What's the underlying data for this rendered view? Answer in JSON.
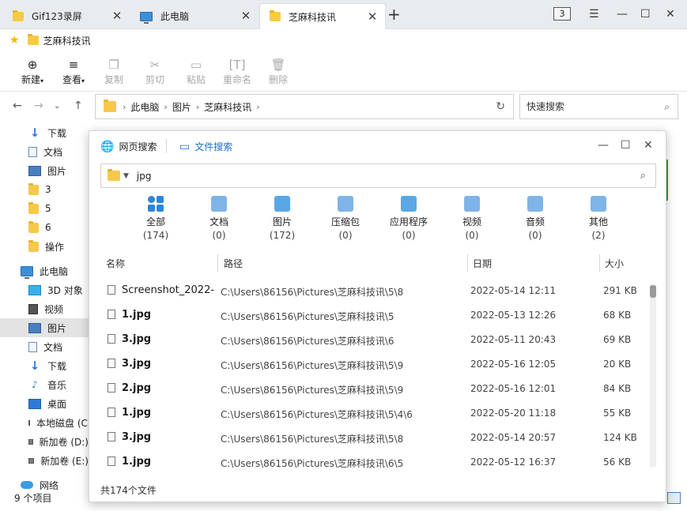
{
  "tabs": [
    {
      "label": "Gif123录屏",
      "icon": "folder-icon"
    },
    {
      "label": "此电脑",
      "icon": "computer-icon"
    },
    {
      "label": "芝麻科技讯",
      "icon": "folder-icon"
    }
  ],
  "tab_count": "3",
  "bookmark": {
    "label": "芝麻科技讯"
  },
  "toolbar": {
    "new": "新建",
    "view": "查看",
    "copy": "复制",
    "cut": "剪切",
    "paste": "粘贴",
    "rename": "重命名",
    "delete": "删除"
  },
  "address": {
    "crumbs": [
      "此电脑",
      "图片",
      "芝麻科技讯"
    ],
    "search_placeholder": "快速搜索"
  },
  "sidebar": {
    "items": [
      "下载",
      "文档",
      "图片",
      "3",
      "5",
      "6",
      "操作",
      "此电脑",
      "3D 对象",
      "视频",
      "图片",
      "文档",
      "下载",
      "音乐",
      "桌面",
      "本地磁盘 (C:)",
      "新加卷 (D:)",
      "新加卷 (E:)",
      "网络"
    ]
  },
  "status": {
    "count": "9 个项目"
  },
  "dialog": {
    "tab_web": "网页搜索",
    "tab_file": "文件搜索",
    "query": "jpg",
    "categories": [
      {
        "label": "全部",
        "count": "(174)"
      },
      {
        "label": "文档",
        "count": "(0)"
      },
      {
        "label": "图片",
        "count": "(172)"
      },
      {
        "label": "压缩包",
        "count": "(0)"
      },
      {
        "label": "应用程序",
        "count": "(0)"
      },
      {
        "label": "视频",
        "count": "(0)"
      },
      {
        "label": "音频",
        "count": "(0)"
      },
      {
        "label": "其他",
        "count": "(2)"
      }
    ],
    "columns": {
      "name": "名称",
      "path": "路径",
      "date": "日期",
      "size": "大小"
    },
    "rows": [
      {
        "name": "Screenshot_2022-",
        "path": "C:\\Users\\86156\\Pictures\\芝麻科技讯\\5\\8",
        "date": "2022-05-14 12:11",
        "size": "291 KB"
      },
      {
        "name": "1.jpg",
        "path": "C:\\Users\\86156\\Pictures\\芝麻科技讯\\5",
        "date": "2022-05-13 12:26",
        "size": "68 KB"
      },
      {
        "name": "3.jpg",
        "path": "C:\\Users\\86156\\Pictures\\芝麻科技讯\\6",
        "date": "2022-05-11 20:43",
        "size": "69 KB"
      },
      {
        "name": "3.jpg",
        "path": "C:\\Users\\86156\\Pictures\\芝麻科技讯\\5\\9",
        "date": "2022-05-16 12:05",
        "size": "20 KB"
      },
      {
        "name": "2.jpg",
        "path": "C:\\Users\\86156\\Pictures\\芝麻科技讯\\5\\9",
        "date": "2022-05-16 12:01",
        "size": "84 KB"
      },
      {
        "name": "1.jpg",
        "path": "C:\\Users\\86156\\Pictures\\芝麻科技讯\\5\\4\\6",
        "date": "2022-05-20 11:18",
        "size": "55 KB"
      },
      {
        "name": "3.jpg",
        "path": "C:\\Users\\86156\\Pictures\\芝麻科技讯\\5\\8",
        "date": "2022-05-14 20:57",
        "size": "124 KB"
      },
      {
        "name": "1.jpg",
        "path": "C:\\Users\\86156\\Pictures\\芝麻科技讯\\6\\5",
        "date": "2022-05-12 16:37",
        "size": "56 KB"
      }
    ],
    "footer": "共174个文件"
  }
}
